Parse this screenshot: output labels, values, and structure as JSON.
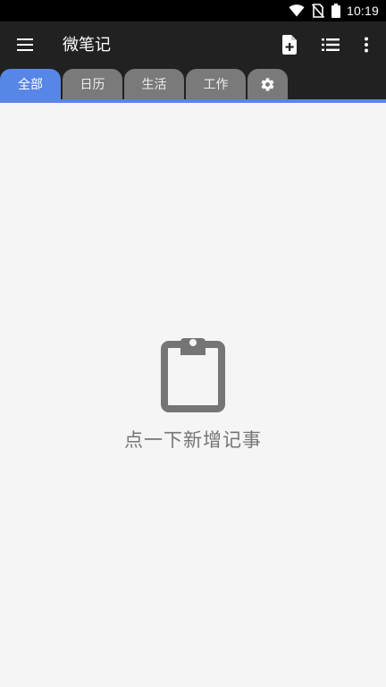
{
  "status_bar": {
    "time": "10:19",
    "icons": [
      "wifi-icon",
      "no-sim-icon",
      "battery-icon"
    ]
  },
  "app_bar": {
    "title": "微笔记",
    "icons": [
      "menu-icon",
      "add-note-icon",
      "list-icon",
      "more-vert-icon"
    ]
  },
  "tabs": [
    {
      "label": "全部",
      "active": true
    },
    {
      "label": "日历",
      "active": false
    },
    {
      "label": "生活",
      "active": false
    },
    {
      "label": "工作",
      "active": false
    },
    {
      "icon": "gear-icon",
      "active": false
    }
  ],
  "empty_state": {
    "icon": "clipboard-icon",
    "text": "点一下新增记事"
  },
  "colors": {
    "status_bar": "#000000",
    "app_bar": "#212121",
    "accent": "#5886e6",
    "tab_inactive": "#7a7a7a",
    "background": "#f5f5f5",
    "muted_text": "#757575"
  }
}
